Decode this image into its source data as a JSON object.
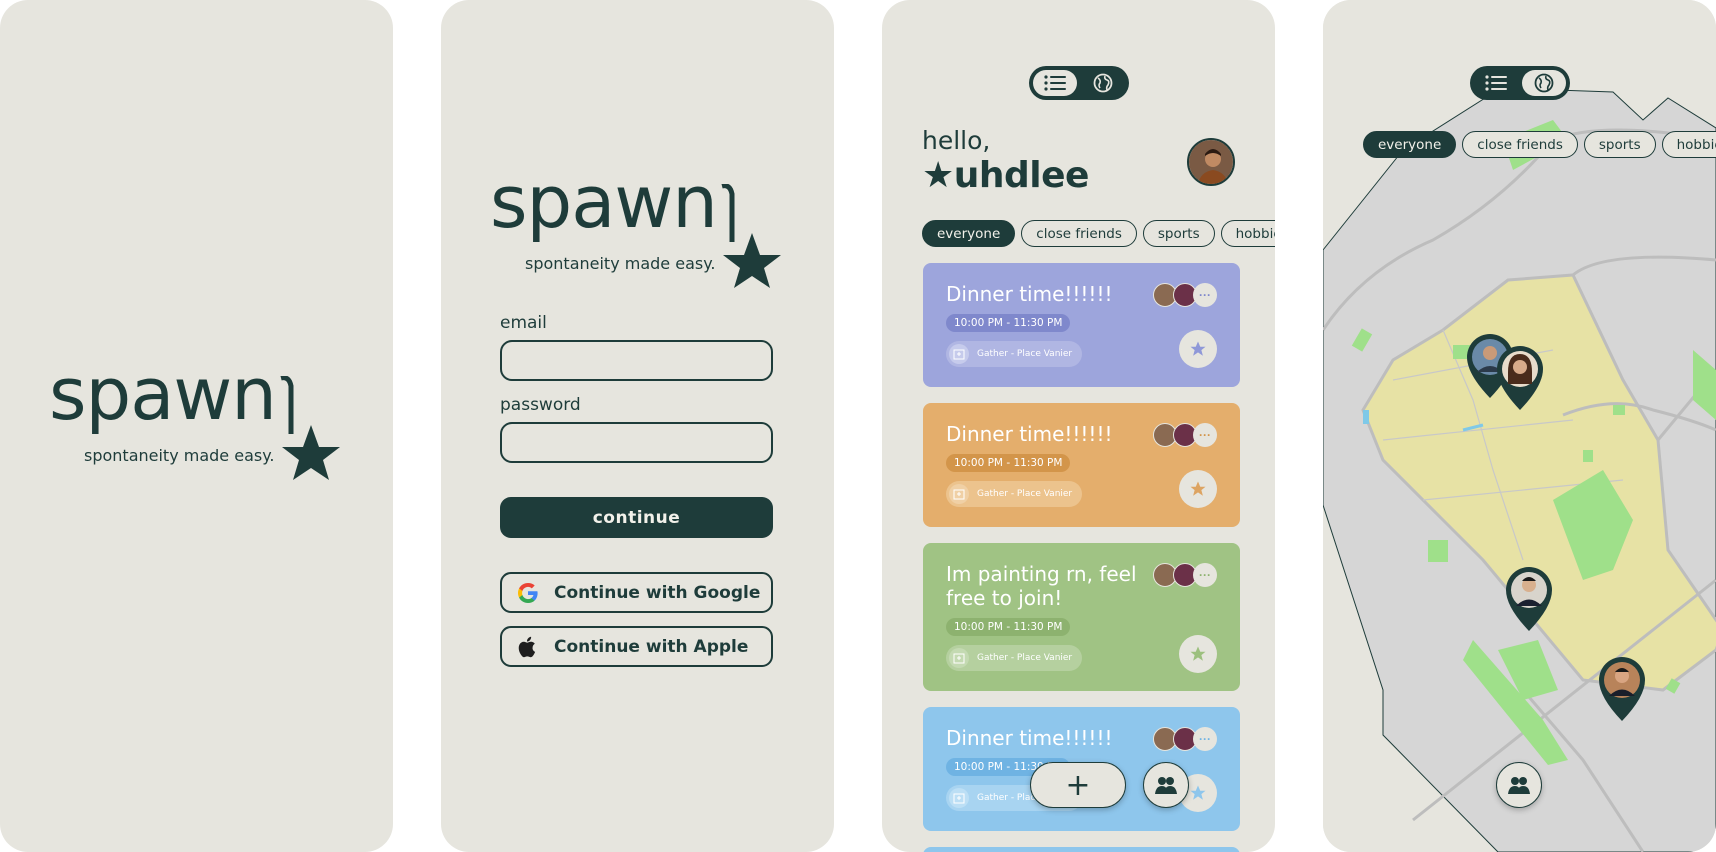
{
  "colors": {
    "background": "#e6e5de",
    "brand": "#1e3c3a",
    "card_purple": "#9da5dc",
    "card_orange": "#e4ae6c",
    "card_green": "#a0c384",
    "card_blue": "#8ec6ec",
    "map_land": "#e7e2a5",
    "map_green": "#9fe08a",
    "map_gray": "#d7d7d7"
  },
  "splash": {
    "logo": "spawn",
    "tagline": "spontaneity made easy."
  },
  "login": {
    "logo": "spawn",
    "tagline": "spontaneity made easy.",
    "email_label": "email",
    "email_value": "",
    "password_label": "password",
    "password_value": "",
    "continue_label": "continue",
    "google_label": "Continue with Google",
    "apple_label": "Continue with Apple"
  },
  "feed": {
    "view_toggle": {
      "list_icon": "list-icon",
      "map_icon": "globe-icon",
      "active": "list"
    },
    "greeting": "hello,",
    "username": "★uhdlee",
    "filters": [
      "everyone",
      "close friends",
      "sports",
      "hobbies"
    ],
    "active_filter": "everyone",
    "events": [
      {
        "title": "Dinner time!!!!!!",
        "time": "10:00 PM - 11:30 PM",
        "location": "Gather - Place Vanier",
        "more": "···",
        "color": "#9da5dc"
      },
      {
        "title": "Dinner time!!!!!!",
        "time": "10:00 PM - 11:30 PM",
        "location": "Gather - Place Vanier",
        "more": "···",
        "color": "#e4ae6c"
      },
      {
        "title": "Im painting rn, feel free to join!",
        "time": "10:00 PM - 11:30 PM",
        "location": "Gather - Place Vanier",
        "more": "···",
        "color": "#a0c384"
      },
      {
        "title": "Dinner time!!!!!!",
        "time": "10:00 PM - 11:30 PM",
        "location": "Gather - Place Vanier",
        "more": "···",
        "color": "#8ec6ec"
      }
    ],
    "add_button": "+",
    "friends_icon": "people-icon"
  },
  "map": {
    "view_toggle": {
      "list_icon": "list-icon",
      "map_icon": "globe-icon",
      "active": "map"
    },
    "filters": [
      "everyone",
      "close friends",
      "sports",
      "hobbies"
    ],
    "active_filter": "everyone",
    "friends_icon": "people-icon"
  }
}
